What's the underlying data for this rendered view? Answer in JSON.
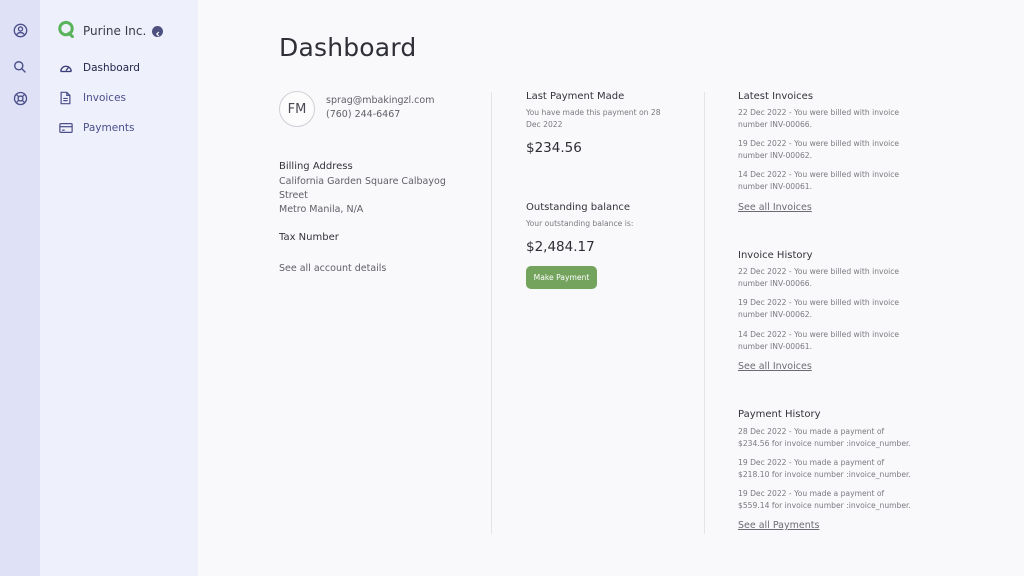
{
  "brand": {
    "name": "Purine Inc.",
    "logo_icon": "logo-ring-icon",
    "accent": "#59b35a"
  },
  "rail": [
    {
      "icon": "user-circle-icon"
    },
    {
      "icon": "search-icon"
    },
    {
      "icon": "lifebuoy-icon"
    }
  ],
  "nav": [
    {
      "label": "Dashboard",
      "icon": "gauge-icon",
      "active": true
    },
    {
      "label": "Invoices",
      "icon": "document-icon",
      "active": false
    },
    {
      "label": "Payments",
      "icon": "credit-card-icon",
      "active": false
    }
  ],
  "page": {
    "title": "Dashboard"
  },
  "account": {
    "initials": "FM",
    "email": "sprag@mbakingzl.com",
    "phone": "(760) 244-6467",
    "billing_heading": "Billing Address",
    "address_line1": "California Garden Square Calbayog",
    "address_line2": "Street",
    "address_line3": "Metro Manila, N/A",
    "tax_heading": "Tax Number",
    "details_link": "See all account details"
  },
  "last_payment": {
    "heading": "Last Payment Made",
    "desc_line1": "You have made this payment on 28",
    "desc_line2": "Dec 2022",
    "amount": "$234.56"
  },
  "outstanding": {
    "heading": "Outstanding balance",
    "desc": "Your outstanding balance is:",
    "amount": "$2,484.17",
    "button_label": "Make Payment",
    "button_color": "#73a35c"
  },
  "latest_invoices": {
    "heading": "Latest Invoices",
    "items": [
      {
        "line1": "22 Dec 2022 - You were billed with invoice",
        "line2": "number INV-00066."
      },
      {
        "line1": "19 Dec 2022 - You were billed with invoice",
        "line2": "number INV-00062."
      },
      {
        "line1": "14 Dec 2022 - You were billed with invoice",
        "line2": "number INV-00061."
      }
    ],
    "link": "See all Invoices"
  },
  "invoice_history": {
    "heading": "Invoice History",
    "items": [
      {
        "line1": "22 Dec 2022 - You were billed with invoice",
        "line2": "number INV-00066."
      },
      {
        "line1": "19 Dec 2022 - You were billed with invoice",
        "line2": "number INV-00062."
      },
      {
        "line1": "14 Dec 2022 - You were billed with invoice",
        "line2": "number INV-00061."
      }
    ],
    "link": "See all Invoices"
  },
  "payment_history": {
    "heading": "Payment History",
    "items": [
      {
        "line1": "28 Dec 2022 - You made a payment of",
        "line2": "$234.56 for invoice number :invoice_number."
      },
      {
        "line1": "19 Dec 2022 - You made a payment of",
        "line2": "$218.10 for invoice number :invoice_number."
      },
      {
        "line1": "19 Dec 2022 - You made a payment of",
        "line2": "$559.14 for invoice number :invoice_number."
      }
    ],
    "link": "See all Payments"
  }
}
